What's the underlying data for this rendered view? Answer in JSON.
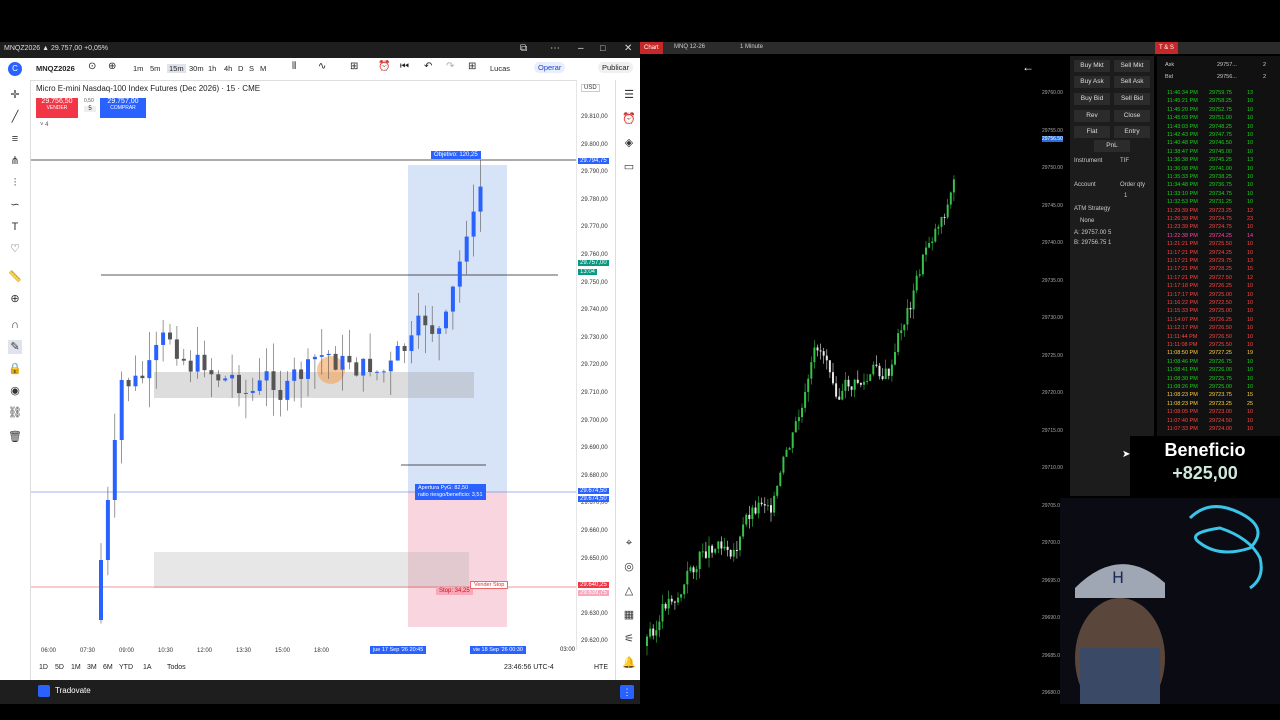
{
  "left_window": {
    "title": "MNQZ2026 ▲ 29.757,00 +0,05%",
    "symbol": "MNQZ2026",
    "timeframes": [
      "1m",
      "5m",
      "15m",
      "30m",
      "1h",
      "4h",
      "D",
      "S",
      "M"
    ],
    "user": "Lucas",
    "operar_label": "Operar",
    "publish_label": "Publicar",
    "instrument_title": "Micro E-mini Nasdaq-100 Index Futures (Dec 2026) · 15 · CME",
    "sell_price": "29.756,50",
    "sell_label": "VENDER",
    "spread": "0,50",
    "qty": "5",
    "buy_price": "29.757,00",
    "buy_label": "COMPRAR",
    "indicator_count": "4",
    "currency": "USD",
    "target_label": "Objetivo: 120,25",
    "entry_label_1": "Apertura PyG: 82,50",
    "entry_label_2": "ratio riesgo/beneficio: 3,51",
    "stop_label": "Stop: 34,25",
    "sell_stop_label": "Vender Stop",
    "price_labels": [
      "29.810,00",
      "29.800,00",
      "29.790,00",
      "29.780,00",
      "29.770,00",
      "29.760,00",
      "29.750,00",
      "29.740,00",
      "29.730,00",
      "29.720,00",
      "29.710,00",
      "29.700,00",
      "29.690,00",
      "29.680,00",
      "29.670,00",
      "29.660,00",
      "29.650,00",
      "29.640,00",
      "29.630,00",
      "29.620,00"
    ],
    "price_tag_target": "29.794,75",
    "price_tag_current": "29.757,00",
    "price_tag_timer": "13:04",
    "price_tag_entry_1": "29.674,50",
    "price_tag_entry_2": "29.674,50",
    "price_tag_stop_1": "29.640,25",
    "price_tag_stop_2": "29.639,75",
    "time_labels": [
      "06:00",
      "07:30",
      "09:00",
      "10:30",
      "12:00",
      "13:30",
      "15:00",
      "18:00"
    ],
    "time_tag_1": "jue 17 Sep '26  20:45",
    "time_tag_2": "vie 18 Sep '26  00:30",
    "time_tag_3": "03:00",
    "ranges": [
      "1D",
      "5D",
      "1M",
      "3M",
      "6M",
      "YTD",
      "1A",
      "Todos"
    ],
    "clock": "23:46:56 UTC-4",
    "session": "HTE",
    "broker": "Tradovate"
  },
  "right_window": {
    "chart_tab": "Chart",
    "instrument": "MNQ 12-26",
    "interval": "1 Minute",
    "ts_label": "T & S",
    "ask_label": "Ask",
    "ask_value": "29757...",
    "ask_size": "2",
    "bid_label": "Bid",
    "bid_value": "29756...",
    "bid_size": "2",
    "buttons": [
      "Buy Mkt",
      "Sell Mkt",
      "Buy Ask",
      "Sell Ask",
      "Buy Bid",
      "Sell Bid",
      "Rev",
      "Close",
      "Flat",
      "Entry",
      "PnL"
    ],
    "instrument_label": "Instrument",
    "tif_label": "TIF",
    "account_label": "Account",
    "order_qty_label": "Order qty",
    "order_qty": "1",
    "atm_label": "ATM Strategy",
    "atm_value": "None",
    "a_line": "A:  29757.00    5",
    "b_line": "B:  29756.75    1",
    "axis_labels": [
      "29760.00",
      "29756.50",
      "29755.00",
      "29750.00",
      "29745.00",
      "29740.00",
      "29735.00",
      "29730.00",
      "29725.00",
      "29720.00",
      "29715.00",
      "29710.00",
      "29705.00",
      "29700.00",
      "29695.00",
      "29690.00",
      "29685.00",
      "29680.00"
    ],
    "ts_rows": [
      {
        "t": "11:46:34 PM",
        "p": "29759.75",
        "s": "13",
        "c": "#18d418"
      },
      {
        "t": "11:45:21 PM",
        "p": "29758.25",
        "s": "10",
        "c": "#18d418"
      },
      {
        "t": "11:45:20 PM",
        "p": "29752.75",
        "s": "10",
        "c": "#18d418"
      },
      {
        "t": "11:45:03 PM",
        "p": "29751.00",
        "s": "10",
        "c": "#18d418"
      },
      {
        "t": "11:43:03 PM",
        "p": "29748.25",
        "s": "10",
        "c": "#18d418"
      },
      {
        "t": "11:42:43 PM",
        "p": "29747.75",
        "s": "10",
        "c": "#18d418"
      },
      {
        "t": "11:40:48 PM",
        "p": "29746.50",
        "s": "10",
        "c": "#18d418"
      },
      {
        "t": "11:38:47 PM",
        "p": "29745.00",
        "s": "10",
        "c": "#18d418"
      },
      {
        "t": "11:36:38 PM",
        "p": "29745.25",
        "s": "13",
        "c": "#18d418"
      },
      {
        "t": "11:36:08 PM",
        "p": "29741.00",
        "s": "10",
        "c": "#18d418"
      },
      {
        "t": "11:35:33 PM",
        "p": "29738.25",
        "s": "10",
        "c": "#18d418"
      },
      {
        "t": "11:34:48 PM",
        "p": "29736.75",
        "s": "10",
        "c": "#18d418"
      },
      {
        "t": "11:33:10 PM",
        "p": "29734.75",
        "s": "10",
        "c": "#18d418"
      },
      {
        "t": "11:32:53 PM",
        "p": "29731.25",
        "s": "10",
        "c": "#18d418"
      },
      {
        "t": "11:29:39 PM",
        "p": "29723.25",
        "s": "12",
        "c": "#ff4444"
      },
      {
        "t": "11:26:39 PM",
        "p": "29724.75",
        "s": "23",
        "c": "#ff4444"
      },
      {
        "t": "11:23:39 PM",
        "p": "29724.75",
        "s": "10",
        "c": "#ff4444"
      },
      {
        "t": "11:22:38 PM",
        "p": "29724.25",
        "s": "14",
        "c": "#ff44aa"
      },
      {
        "t": "11:21:21 PM",
        "p": "29725.50",
        "s": "10",
        "c": "#ff4444"
      },
      {
        "t": "11:17:21 PM",
        "p": "29724.25",
        "s": "10",
        "c": "#ff4444"
      },
      {
        "t": "11:17:21 PM",
        "p": "29729.75",
        "s": "13",
        "c": "#ff4444"
      },
      {
        "t": "11:17:21 PM",
        "p": "29728.25",
        "s": "15",
        "c": "#ff4444"
      },
      {
        "t": "11:17:21 PM",
        "p": "29727.50",
        "s": "12",
        "c": "#ff4444"
      },
      {
        "t": "11:17:18 PM",
        "p": "29726.25",
        "s": "10",
        "c": "#ff4444"
      },
      {
        "t": "11:17:17 PM",
        "p": "29725.00",
        "s": "10",
        "c": "#ff4444"
      },
      {
        "t": "11:16:22 PM",
        "p": "29722.50",
        "s": "10",
        "c": "#ff4444"
      },
      {
        "t": "11:15:33 PM",
        "p": "29725.00",
        "s": "10",
        "c": "#ff4444"
      },
      {
        "t": "11:14:07 PM",
        "p": "29726.25",
        "s": "10",
        "c": "#ff4444"
      },
      {
        "t": "11:12:17 PM",
        "p": "29726.50",
        "s": "10",
        "c": "#ff4444"
      },
      {
        "t": "11:11:44 PM",
        "p": "29726.50",
        "s": "10",
        "c": "#ff4444"
      },
      {
        "t": "11:11:08 PM",
        "p": "29725.50",
        "s": "10",
        "c": "#ff4444"
      },
      {
        "t": "11:08:50 PM",
        "p": "29727.25",
        "s": "19",
        "c": "#ffd23a"
      },
      {
        "t": "11:08:46 PM",
        "p": "29726.75",
        "s": "10",
        "c": "#18d418"
      },
      {
        "t": "11:08:41 PM",
        "p": "29726.00",
        "s": "10",
        "c": "#18d418"
      },
      {
        "t": "11:08:30 PM",
        "p": "29725.75",
        "s": "10",
        "c": "#18d418"
      },
      {
        "t": "11:08:26 PM",
        "p": "29725.00",
        "s": "10",
        "c": "#18d418"
      },
      {
        "t": "11:08:23 PM",
        "p": "29723.75",
        "s": "15",
        "c": "#ffd23a"
      },
      {
        "t": "11:08:23 PM",
        "p": "29723.25",
        "s": "25",
        "c": "#ffd23a"
      },
      {
        "t": "11:08:05 PM",
        "p": "29723.00",
        "s": "10",
        "c": "#ff4444"
      },
      {
        "t": "11:07:40 PM",
        "p": "29724.50",
        "s": "10",
        "c": "#ff4444"
      },
      {
        "t": "11:07:33 PM",
        "p": "29724.00",
        "s": "10",
        "c": "#ff4444"
      }
    ]
  },
  "overlay": {
    "beneficio_label": "Beneficio",
    "beneficio_value": "+825,00"
  }
}
